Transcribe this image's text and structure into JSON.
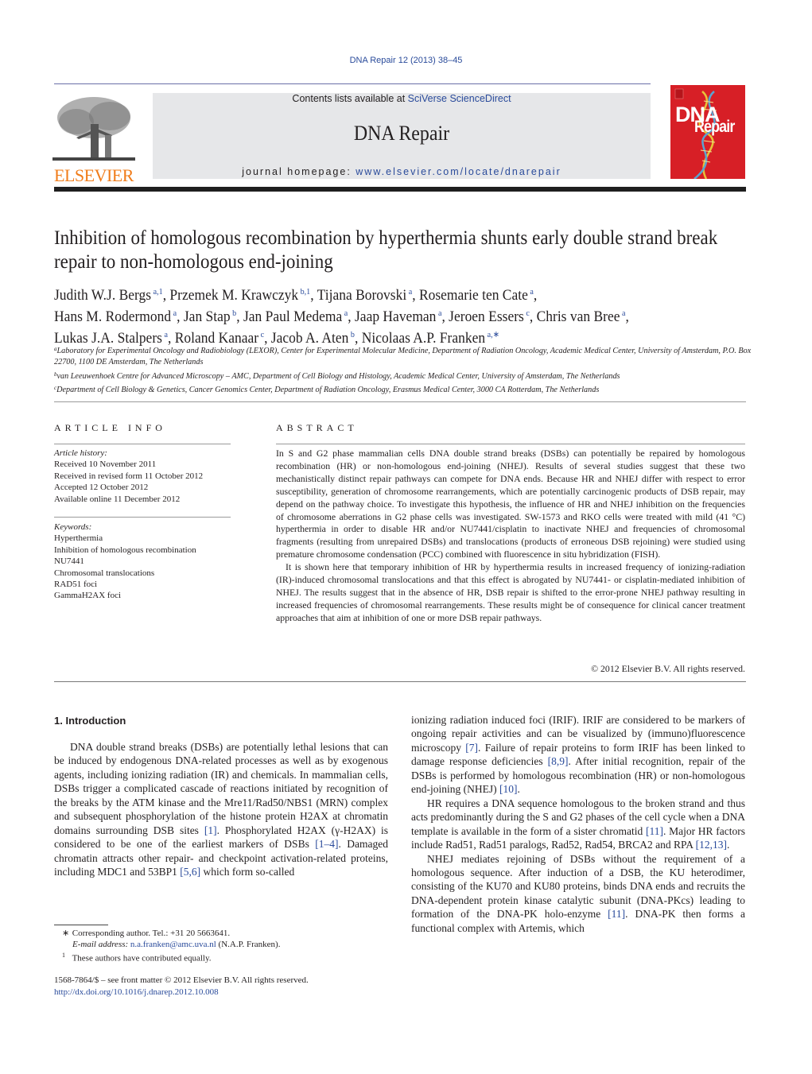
{
  "header": {
    "journal_ref": "DNA Repair 12 (2013) 38–45",
    "contents_prefix": "Contents lists available at ",
    "contents_link": "SciVerse ScienceDirect",
    "journal_name": "DNA Repair",
    "homepage_prefix": "journal homepage: ",
    "homepage_link": "www.elsevier.com/locate/dnarepair",
    "publisher_logo_text": "ELSEVIER",
    "cover": {
      "line1": "DNA",
      "line2": "Repair"
    },
    "colors": {
      "link": "#2a4b9b",
      "elsevier_orange": "#f07c1a",
      "cover_red": "#d71f26",
      "banner_gray": "#e6e7e9"
    }
  },
  "article": {
    "title": "Inhibition of homologous recombination by hyperthermia shunts early double strand break repair to non-homologous end-joining",
    "author_lines": [
      [
        {
          "name": "Judith W.J. Bergs",
          "sup": "a,1"
        },
        {
          "name": "Przemek M. Krawczyk",
          "sup": "b,1"
        },
        {
          "name": "Tijana Borovski",
          "sup": "a"
        },
        {
          "name": "Rosemarie ten Cate",
          "sup": "a"
        }
      ],
      [
        {
          "name": "Hans M. Rodermond",
          "sup": "a"
        },
        {
          "name": "Jan Stap",
          "sup": "b"
        },
        {
          "name": "Jan Paul Medema",
          "sup": "a"
        },
        {
          "name": "Jaap Haveman",
          "sup": "a"
        },
        {
          "name": "Jeroen Essers",
          "sup": "c"
        },
        {
          "name": "Chris van Bree",
          "sup": "a"
        }
      ],
      [
        {
          "name": "Lukas J.A. Stalpers",
          "sup": "a"
        },
        {
          "name": "Roland Kanaar",
          "sup": "c"
        },
        {
          "name": "Jacob A. Aten",
          "sup": "b"
        },
        {
          "name": "Nicolaas A.P. Franken",
          "sup": "a,∗"
        }
      ]
    ],
    "affiliations": [
      {
        "mark": "a",
        "text": "Laboratory for Experimental Oncology and Radiobiology (LEXOR), Center for Experimental Molecular Medicine, Department of Radiation Oncology, Academic Medical Center, University of Amsterdam, P.O. Box 22700, 1100 DE Amsterdam, The Netherlands"
      },
      {
        "mark": "b",
        "text": "van Leeuwenhoek Centre for Advanced Microscopy – AMC, Department of Cell Biology and Histology, Academic Medical Center, University of Amsterdam, The Netherlands"
      },
      {
        "mark": "c",
        "text": "Department of Cell Biology & Genetics, Cancer Genomics Center, Department of Radiation Oncology, Erasmus Medical Center, 3000 CA Rotterdam, The Netherlands"
      }
    ]
  },
  "article_info": {
    "heading": "ARTICLE INFO",
    "history_label": "Article history:",
    "history": [
      "Received 10 November 2011",
      "Received in revised form 11 October 2012",
      "Accepted 12 October 2012",
      "Available online 11 December 2012"
    ],
    "keywords_label": "Keywords:",
    "keywords": [
      "Hyperthermia",
      "Inhibition of homologous recombination",
      "NU7441",
      "Chromosomal translocations",
      "RAD51 foci",
      "GammaH2AX foci"
    ]
  },
  "abstract": {
    "heading": "ABSTRACT",
    "paragraphs": [
      "In S and G2 phase mammalian cells DNA double strand breaks (DSBs) can potentially be repaired by homologous recombination (HR) or non-homologous end-joining (NHEJ). Results of several studies suggest that these two mechanistically distinct repair pathways can compete for DNA ends. Because HR and NHEJ differ with respect to error susceptibility, generation of chromosome rearrangements, which are potentially carcinogenic products of DSB repair, may depend on the pathway choice. To investigate this hypothesis, the influence of HR and NHEJ inhibition on the frequencies of chromosome aberrations in G2 phase cells was investigated. SW-1573 and RKO cells were treated with mild (41 °C) hyperthermia in order to disable HR and/or NU7441/cisplatin to inactivate NHEJ and frequencies of chromosomal fragments (resulting from unrepaired DSBs) and translocations (products of erroneous DSB rejoining) were studied using premature chromosome condensation (PCC) combined with fluorescence in situ hybridization (FISH).",
      "It is shown here that temporary inhibition of HR by hyperthermia results in increased frequency of ionizing-radiation (IR)-induced chromosomal translocations and that this effect is abrogated by NU7441- or cisplatin-mediated inhibition of NHEJ. The results suggest that in the absence of HR, DSB repair is shifted to the error-prone NHEJ pathway resulting in increased frequencies of chromosomal rearrangements. These results might be of consequence for clinical cancer treatment approaches that aim at inhibition of one or more DSB repair pathways."
    ],
    "copyright": "© 2012 Elsevier B.V. All rights reserved."
  },
  "introduction": {
    "heading": "1.  Introduction",
    "left_paragraph": [
      {
        "t": "DNA double strand breaks (DSBs) are potentially lethal lesions that can be induced by endogenous DNA-related processes as well as by exogenous agents, including ionizing radiation (IR) and chemicals. In mammalian cells, DSBs trigger a complicated cascade of reactions initiated by recognition of the breaks by the ATM kinase and the Mre11/Rad50/NBS1 (MRN) complex and subsequent phosphorylation of the histone protein H2AX at chromatin domains surrounding DSB sites "
      },
      {
        "ref": "[1]"
      },
      {
        "t": ". Phosphorylated H2AX (γ-H2AX) is considered to be one of the earliest markers of DSBs "
      },
      {
        "ref": "[1–4]"
      },
      {
        "t": ". Damaged chromatin attracts other repair- and checkpoint activation-related proteins, including MDC1 and 53BP1 "
      },
      {
        "ref": "[5,6]"
      },
      {
        "t": " which form so-called"
      }
    ],
    "right_paragraphs": [
      [
        {
          "t": "ionizing radiation induced foci (IRIF). IRIF are considered to be markers of ongoing repair activities and can be visualized by (immuno)fluorescence microscopy "
        },
        {
          "ref": "[7]"
        },
        {
          "t": ". Failure of repair proteins to form IRIF has been linked to damage response deficiencies "
        },
        {
          "ref": "[8,9]"
        },
        {
          "t": ". After initial recognition, repair of the DSBs is performed by homologous recombination (HR) or non-homologous end-joining (NHEJ) "
        },
        {
          "ref": "[10]"
        },
        {
          "t": "."
        }
      ],
      [
        {
          "t": "HR requires a DNA sequence homologous to the broken strand and thus acts predominantly during the S and G2 phases of the cell cycle when a DNA template is available in the form of a sister chromatid "
        },
        {
          "ref": "[11]"
        },
        {
          "t": ". Major HR factors include Rad51, Rad51 paralogs, Rad52, Rad54, BRCA2 and RPA "
        },
        {
          "ref": "[12,13]"
        },
        {
          "t": "."
        }
      ],
      [
        {
          "t": "NHEJ mediates rejoining of DSBs without the requirement of a homologous sequence. After induction of a DSB, the KU heterodimer, consisting of the KU70 and KU80 proteins, binds DNA ends and recruits the DNA-dependent protein kinase catalytic subunit (DNA-PKcs) leading to formation of the DNA-PK holo-enzyme "
        },
        {
          "ref": "[11]"
        },
        {
          "t": ". DNA-PK then forms a functional complex with Artemis, which"
        }
      ]
    ]
  },
  "footnotes": {
    "corresponding_mark": "∗",
    "corresponding_text": "Corresponding author. Tel.: +31 20 5663641.",
    "email_label": "E-mail address: ",
    "email": "n.a.franken@amc.uva.nl",
    "email_suffix": " (N.A.P. Franken).",
    "equal_mark": "1",
    "equal_text": "These authors have contributed equally."
  },
  "front_matter": {
    "issn_line": "1568-7864/$ – see front matter © 2012 Elsevier B.V. All rights reserved.",
    "doi": "http://dx.doi.org/10.1016/j.dnarep.2012.10.008"
  }
}
